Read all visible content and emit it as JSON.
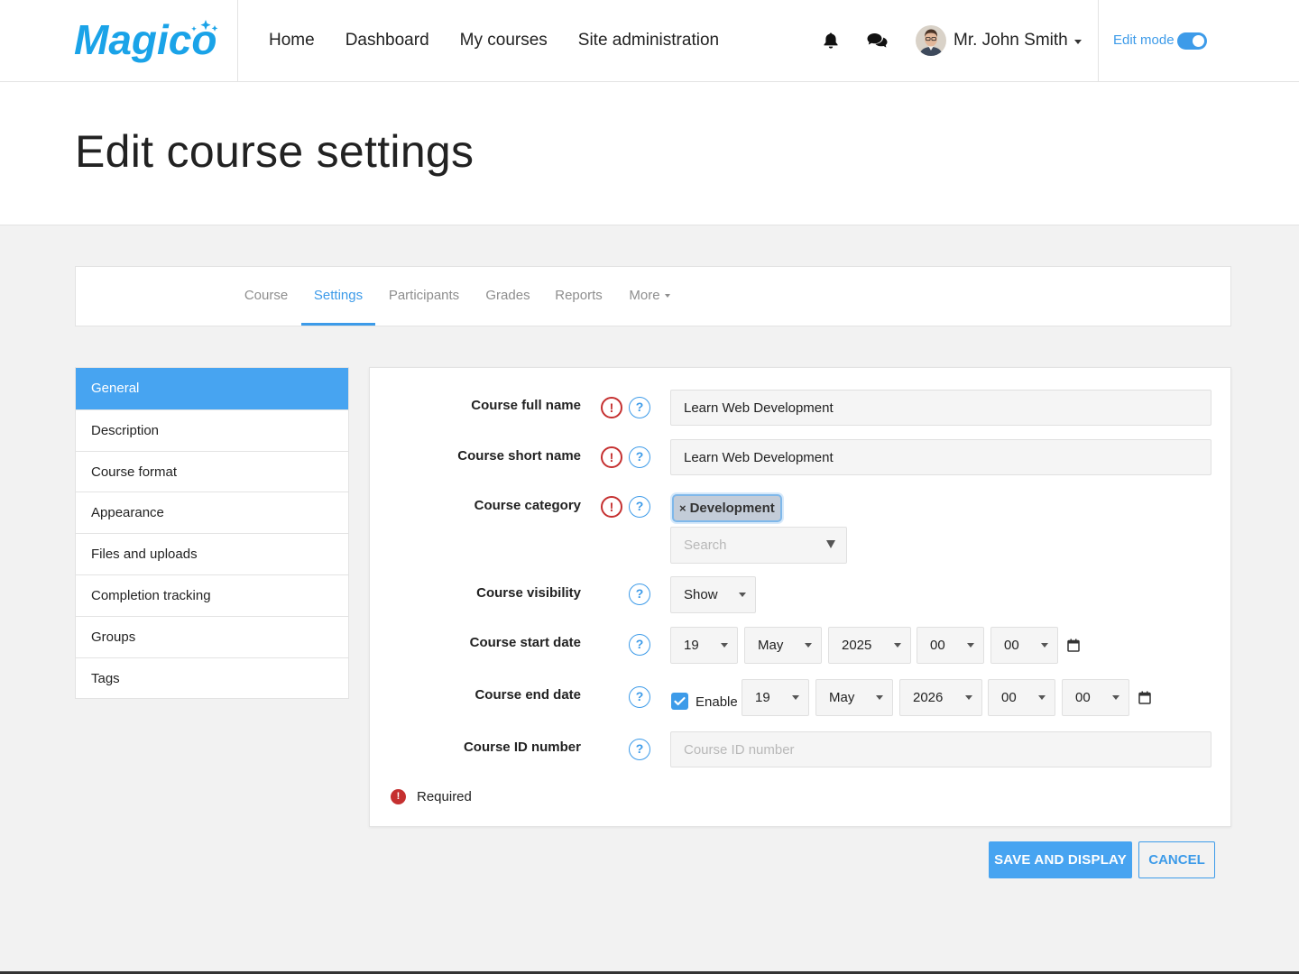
{
  "brand": {
    "logo_text": "Magico",
    "accent": "#3d9be9"
  },
  "nav": {
    "links": [
      "Home",
      "Dashboard",
      "My courses",
      "Site administration"
    ]
  },
  "user": {
    "name": "Mr. John Smith"
  },
  "edit_mode": {
    "label": "Edit mode",
    "enabled": true
  },
  "page": {
    "title": "Edit course settings"
  },
  "course_tabs": {
    "items": [
      "Course",
      "Settings",
      "Participants",
      "Grades",
      "Reports",
      "More"
    ],
    "active": "Settings"
  },
  "sections": {
    "items": [
      "General",
      "Description",
      "Course format",
      "Appearance",
      "Files and uploads",
      "Completion tracking",
      "Groups",
      "Tags"
    ],
    "active": "General"
  },
  "form": {
    "full_name": {
      "label": "Course full name",
      "value": "Learn Web Development"
    },
    "short_name": {
      "label": "Course short name",
      "value": "Learn Web Development"
    },
    "category": {
      "label": "Course category",
      "selected": "Development",
      "search_placeholder": "Search"
    },
    "visibility": {
      "label": "Course visibility",
      "value": "Show"
    },
    "start_date": {
      "label": "Course start date",
      "day": "19",
      "month": "May",
      "year": "2025",
      "hour": "00",
      "minute": "00"
    },
    "end_date": {
      "label": "Course end date",
      "enable_label": "Enable",
      "enabled": true,
      "day": "19",
      "month": "May",
      "year": "2026",
      "hour": "00",
      "minute": "00"
    },
    "id_number": {
      "label": "Course ID number",
      "placeholder": "Course ID number"
    },
    "required_note": "Required"
  },
  "actions": {
    "save_label": "SAVE AND DISPLAY",
    "cancel_label": "CANCEL"
  }
}
